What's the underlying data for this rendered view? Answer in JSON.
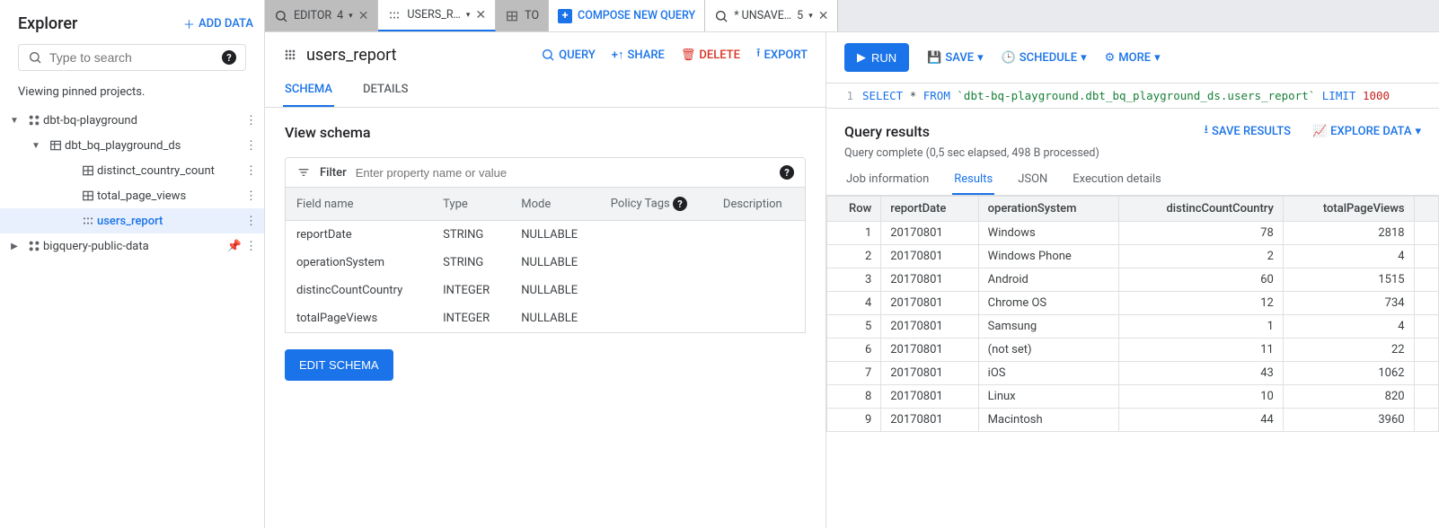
{
  "sidebar": {
    "title": "Explorer",
    "add_data": "ADD DATA",
    "search_placeholder": "Type to search",
    "viewing": "Viewing pinned projects.",
    "tree": [
      {
        "label": "dbt-bq-playground",
        "icon": "project",
        "indent": 0,
        "expanded": true,
        "selected": false
      },
      {
        "label": "dbt_bq_playground_ds",
        "icon": "dataset",
        "indent": 1,
        "expanded": true,
        "selected": false
      },
      {
        "label": "distinct_country_count",
        "icon": "table",
        "indent": 2,
        "expanded": null,
        "selected": false
      },
      {
        "label": "total_page_views",
        "icon": "table",
        "indent": 2,
        "expanded": null,
        "selected": false
      },
      {
        "label": "users_report",
        "icon": "view",
        "indent": 2,
        "expanded": null,
        "selected": true
      },
      {
        "label": "bigquery-public-data",
        "icon": "project",
        "indent": 0,
        "expanded": false,
        "selected": false,
        "pinned": true
      }
    ]
  },
  "tabs": [
    {
      "kind": "grey",
      "icon": "query",
      "label": "EDITOR",
      "badge": "4",
      "close": true
    },
    {
      "kind": "active",
      "icon": "view",
      "label": "USERS_R…",
      "close": true
    },
    {
      "kind": "grey",
      "icon": "table",
      "label": "TO",
      "partial": true
    },
    {
      "kind": "white",
      "icon": "plus",
      "label": "COMPOSE NEW QUERY",
      "compose": true
    },
    {
      "kind": "white",
      "icon": "query",
      "label": "* UNSAVE…",
      "badge": "5",
      "close": true
    }
  ],
  "detail": {
    "title": "users_report",
    "actions": {
      "query": "QUERY",
      "share": "SHARE",
      "delete": "DELETE",
      "export": "EXPORT"
    },
    "subtabs": {
      "schema": "SCHEMA",
      "details": "DETAILS"
    },
    "schema_heading": "View schema",
    "filter_label": "Filter",
    "filter_placeholder": "Enter property name or value",
    "columns": {
      "field": "Field name",
      "type": "Type",
      "mode": "Mode",
      "policy": "Policy Tags",
      "desc": "Description"
    },
    "fields": [
      {
        "name": "reportDate",
        "type": "STRING",
        "mode": "NULLABLE"
      },
      {
        "name": "operationSystem",
        "type": "STRING",
        "mode": "NULLABLE"
      },
      {
        "name": "distincCountCountry",
        "type": "INTEGER",
        "mode": "NULLABLE"
      },
      {
        "name": "totalPageViews",
        "type": "INTEGER",
        "mode": "NULLABLE"
      }
    ],
    "edit_schema": "EDIT SCHEMA"
  },
  "query": {
    "toolbar": {
      "run": "RUN",
      "save": "SAVE",
      "schedule": "SCHEDULE",
      "more": "MORE"
    },
    "line_no": "1",
    "sql": {
      "select": "SELECT",
      "star": "*",
      "from": "FROM",
      "table": "`dbt-bq-playground.dbt_bq_playground_ds.users_report`",
      "limit": "LIMIT",
      "n": "1000"
    },
    "results_title": "Query results",
    "save_results": "SAVE RESULTS",
    "explore_data": "EXPLORE DATA",
    "status": "Query complete (0,5 sec elapsed, 498 B processed)",
    "res_tabs": {
      "job": "Job information",
      "results": "Results",
      "json": "JSON",
      "exec": "Execution details"
    },
    "columns": [
      "Row",
      "reportDate",
      "operationSystem",
      "distincCountCountry",
      "totalPageViews"
    ],
    "rows": [
      {
        "row": 1,
        "reportDate": "20170801",
        "os": "Windows",
        "dcc": 78,
        "tpv": 2818
      },
      {
        "row": 2,
        "reportDate": "20170801",
        "os": "Windows Phone",
        "dcc": 2,
        "tpv": 4
      },
      {
        "row": 3,
        "reportDate": "20170801",
        "os": "Android",
        "dcc": 60,
        "tpv": 1515
      },
      {
        "row": 4,
        "reportDate": "20170801",
        "os": "Chrome OS",
        "dcc": 12,
        "tpv": 734
      },
      {
        "row": 5,
        "reportDate": "20170801",
        "os": "Samsung",
        "dcc": 1,
        "tpv": 4
      },
      {
        "row": 6,
        "reportDate": "20170801",
        "os": "(not set)",
        "dcc": 11,
        "tpv": 22
      },
      {
        "row": 7,
        "reportDate": "20170801",
        "os": "iOS",
        "dcc": 43,
        "tpv": 1062
      },
      {
        "row": 8,
        "reportDate": "20170801",
        "os": "Linux",
        "dcc": 10,
        "tpv": 820
      },
      {
        "row": 9,
        "reportDate": "20170801",
        "os": "Macintosh",
        "dcc": 44,
        "tpv": 3960
      }
    ]
  }
}
